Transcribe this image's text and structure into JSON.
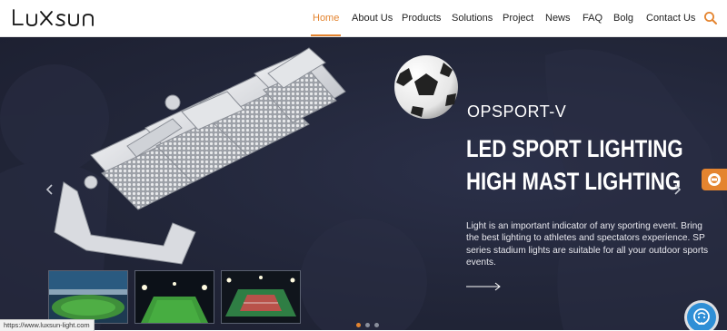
{
  "brand": {
    "logo_text": "LUXSUN"
  },
  "nav": {
    "items": [
      {
        "label": "Home",
        "active": true
      },
      {
        "label": "About Us"
      },
      {
        "label": "Products"
      },
      {
        "label": "Solutions"
      },
      {
        "label": "Project"
      },
      {
        "label": "News"
      },
      {
        "label": "FAQ"
      },
      {
        "label": "Bolg"
      },
      {
        "label": "Contact Us"
      }
    ],
    "search_icon": "search-icon"
  },
  "hero": {
    "subtitle": "OPSPORT-V",
    "headline_1": "LED SPORT LIGHTING",
    "headline_2": "HIGH MAST LIGHTING",
    "description": "Light is an important indicator of any sporting event. Bring the best lighting to athletes and spectators experience. SP series stadium lights are suitable for all your outdoor sports events.",
    "more_icon": "arrow-right-icon",
    "prev_icon": "chevron-left-icon",
    "next_icon": "chevron-right-icon",
    "slides_count": 3,
    "active_slide": 1
  },
  "thumbnails": [
    {
      "icon": "stadium-thumbnail"
    },
    {
      "icon": "football-field-thumbnail"
    },
    {
      "icon": "tennis-court-thumbnail"
    }
  ],
  "status_bar": {
    "url": "https://www.luxsun-light.com"
  },
  "colors": {
    "accent": "#e4842f",
    "hero_bg": "#222639",
    "chat": "#2f8fd6"
  }
}
